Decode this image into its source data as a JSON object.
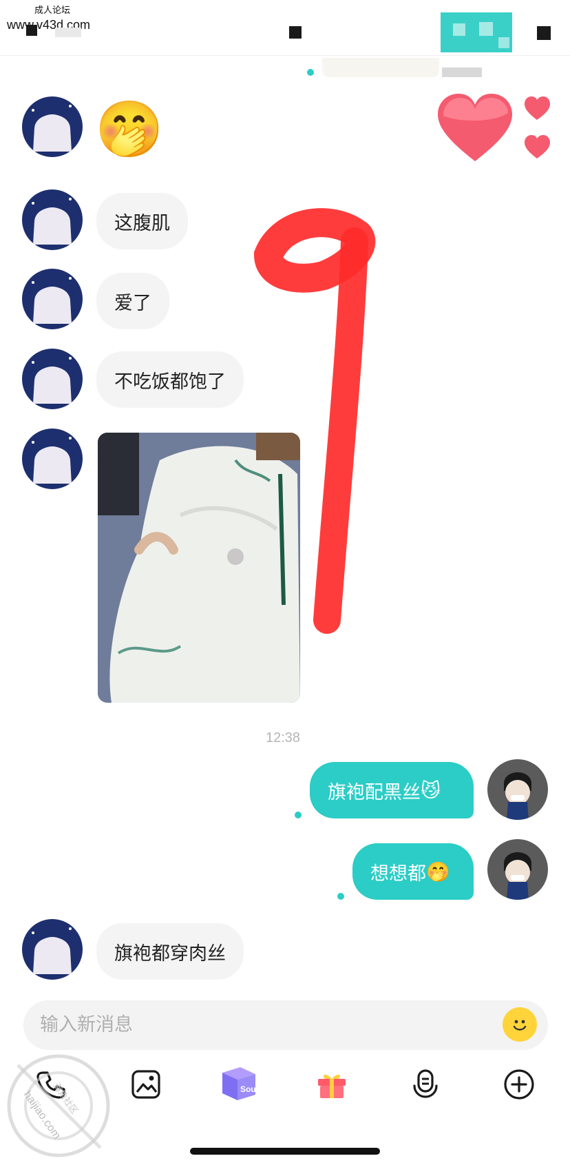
{
  "watermark": {
    "line1": "成人论坛",
    "line2": "www.v43d.com",
    "bottom": "haijiao.com",
    "bottom_cn": "海角社区"
  },
  "colors": {
    "accent": "#2bcdc6",
    "bubble_in": "#f4f4f4",
    "timestamp": "#b5b5b5",
    "annotation": "#ff2b2b"
  },
  "messages": {
    "m1": {
      "sender": "other",
      "kind": "emoji",
      "emoji": "🤭"
    },
    "m2": {
      "sender": "other",
      "text": "这腹肌"
    },
    "m3": {
      "sender": "other",
      "text": "爱了"
    },
    "m4": {
      "sender": "other",
      "text": "不吃饭都饱了"
    },
    "m5": {
      "sender": "other",
      "kind": "photo"
    },
    "timestamp": "12:38",
    "m6": {
      "sender": "me",
      "text": "旗袍配黑丝",
      "emoji": "😼"
    },
    "m7": {
      "sender": "me",
      "text": "想想都",
      "emoji": "🤭"
    },
    "m8": {
      "sender": "other",
      "text": "旗袍都穿肉丝"
    }
  },
  "composer": {
    "placeholder": "输入新消息",
    "emoji_button": "🙂"
  },
  "toolbar": {
    "items": [
      {
        "name": "phone-icon"
      },
      {
        "name": "image-icon"
      },
      {
        "name": "soul-box-icon",
        "label": "Soul"
      },
      {
        "name": "gift-icon"
      },
      {
        "name": "voice-icon"
      },
      {
        "name": "plus-icon"
      }
    ]
  }
}
